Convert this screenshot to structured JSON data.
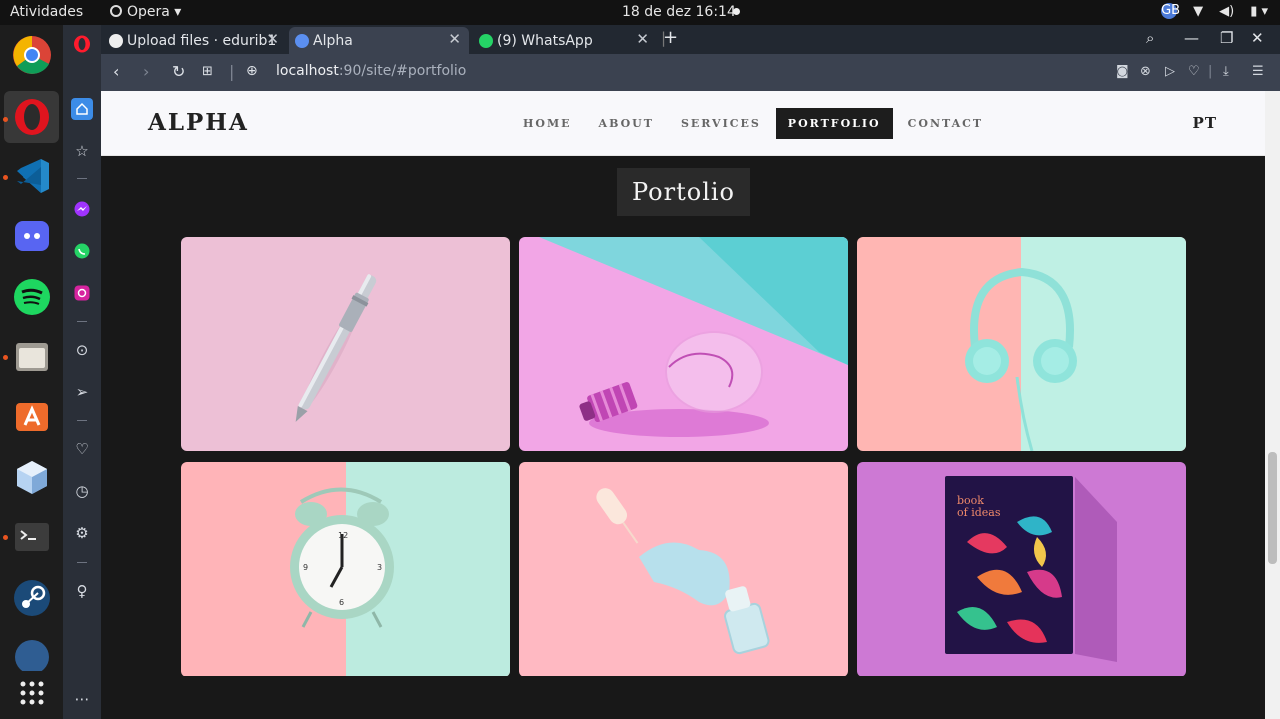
{
  "system": {
    "activities": "Atividades",
    "app_name": "Opera",
    "datetime": "18 de dez  16:14",
    "avatar_initials": "GB"
  },
  "browser": {
    "tabs": [
      {
        "label": "Upload files · edurib1",
        "icon": "github-icon"
      },
      {
        "label": "Alpha",
        "icon": "globe-icon"
      },
      {
        "label": "(9) WhatsApp",
        "icon": "whatsapp-icon"
      }
    ],
    "url_host": "localhost",
    "url_path": ":90/site/#portfolio"
  },
  "site": {
    "brand": "ALPHA",
    "menu": [
      "HOME",
      "ABOUT",
      "SERVICES",
      "PORTFOLIO",
      "CONTACT"
    ],
    "active_menu": "PORTFOLIO",
    "lang": "PT",
    "section_title": "Portolio",
    "portfolio": [
      {
        "subject": "pen",
        "bg": "#edc0d6"
      },
      {
        "subject": "light bulb",
        "bg": "#f2a6e6"
      },
      {
        "subject": "headphones",
        "bg": "#ffb6b3"
      },
      {
        "subject": "alarm clock",
        "bg": "#ffb4b8"
      },
      {
        "subject": "nail polish",
        "bg": "#ffb9c2"
      },
      {
        "subject": "book",
        "bg": "#cd79d4",
        "book_title": "book of ideas"
      }
    ]
  }
}
